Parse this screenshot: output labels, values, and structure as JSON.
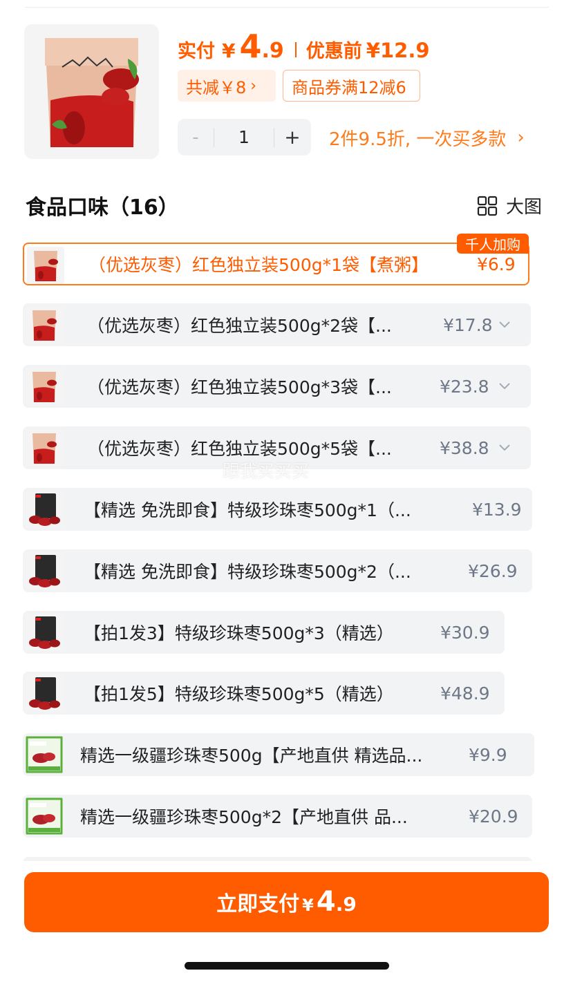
{
  "price": {
    "pay_label": "实付",
    "currency": "¥",
    "pay_int": "4",
    "pay_dec": ".9",
    "orig_label": "优惠前",
    "orig_value": "¥12.9"
  },
  "chips": {
    "savings": "共减￥8",
    "savings_arrow": "›",
    "coupon": "商品券满12减6"
  },
  "quantity": {
    "minus": "-",
    "value": "1",
    "plus": "+"
  },
  "promo": {
    "text": "2件9.5折, 一次买多款",
    "arrow": "›"
  },
  "section": {
    "title": "食品口味（16）",
    "view_toggle": "大图",
    "view_icon": "grid-icon"
  },
  "badge": "千人加购",
  "watermark": "跟我买买买",
  "options": [
    {
      "name": "（优选灰枣）红色独立装500g*1袋【煮粥】",
      "price": "¥6.9",
      "selected": true,
      "has_chevron": false,
      "thumb": "red-bag"
    },
    {
      "name": "（优选灰枣）红色独立装500g*2袋【...",
      "price": "¥17.8",
      "selected": false,
      "has_chevron": true,
      "thumb": "red-bag"
    },
    {
      "name": "（优选灰枣）红色独立装500g*3袋【...",
      "price": "¥23.8",
      "selected": false,
      "has_chevron": true,
      "thumb": "red-bag"
    },
    {
      "name": "（优选灰枣）红色独立装500g*5袋【...",
      "price": "¥38.8",
      "selected": false,
      "has_chevron": true,
      "thumb": "red-bag"
    },
    {
      "name": "【精选 免洗即食】特级珍珠枣500g*1（...",
      "price": "¥13.9",
      "selected": false,
      "has_chevron": false,
      "thumb": "dark-bag"
    },
    {
      "name": "【精选 免洗即食】特级珍珠枣500g*2（...",
      "price": "¥26.9",
      "selected": false,
      "has_chevron": false,
      "thumb": "dark-bag"
    },
    {
      "name": "【拍1发3】特级珍珠枣500g*3（精选）",
      "price": "¥30.9",
      "selected": false,
      "has_chevron": false,
      "thumb": "dark-bag"
    },
    {
      "name": "【拍1发5】特级珍珠枣500g*5（精选）",
      "price": "¥48.9",
      "selected": false,
      "has_chevron": false,
      "thumb": "dark-bag"
    },
    {
      "name": "精选一级疆珍珠枣500g【产地直供 精选品...",
      "price": "¥9.9",
      "selected": false,
      "has_chevron": false,
      "thumb": "green-box"
    },
    {
      "name": "精选一级疆珍珠枣500g*2【产地直供 品...",
      "price": "¥20.9",
      "selected": false,
      "has_chevron": false,
      "thumb": "green-box"
    }
  ],
  "pay_button": {
    "label": "立即支付",
    "currency": "¥",
    "int": "4",
    "dec": ".9"
  },
  "colors": {
    "accent": "#ff5c00",
    "chip_bg": "#fff1e8",
    "option_bg": "#f2f3f5",
    "price_gray": "#6d7787"
  }
}
